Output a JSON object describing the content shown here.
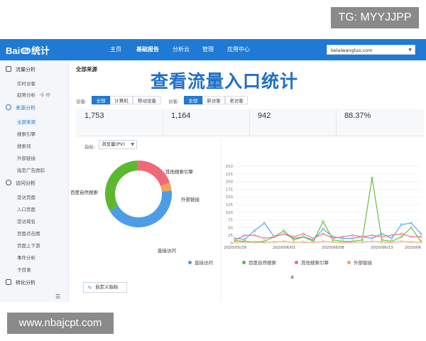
{
  "watermarks": {
    "tg": "TG: MYYJJPP",
    "site": "www.nbajcpt.com"
  },
  "header": {
    "logo_left": "Bai",
    "logo_mid": "du",
    "logo_right": "统计",
    "nav": [
      "主页",
      "基础报告",
      "分析云",
      "管理",
      "应用中心"
    ],
    "active_nav": "基础报告",
    "site_value": "kelaiwangluo.com",
    "brand_color": "#1e7ad4"
  },
  "sidebar": {
    "sections": [
      {
        "title": "流量分析",
        "items": [
          "实时访客",
          "趋势分析"
        ]
      },
      {
        "title": "来源分析",
        "items": [
          "全部来源",
          "搜索引擎",
          "搜索词",
          "外部链接",
          "指定广告跟踪"
        ]
      },
      {
        "title": "访问分析",
        "items": [
          "受访页面",
          "入口页面",
          "受访域名",
          "页面点击图",
          "页面上下游",
          "事件分析",
          "子目录"
        ]
      },
      {
        "title": "转化分析",
        "items": []
      }
    ],
    "trend_badge": "今 昨",
    "active_item": "全部来源"
  },
  "main": {
    "crumb": "全部来源",
    "overlay_title": "查看流量入口统计",
    "device_label": "设备:",
    "device_options": [
      "全部",
      "计算机",
      "移动设备"
    ],
    "visitor_label": "访客:",
    "visitor_options": [
      "全部",
      "新访客",
      "老访客"
    ],
    "metrics": [
      "1,753",
      "1,164",
      "942",
      "88.37%"
    ],
    "indicator_label": "指标:",
    "indicator_value": "浏览量(PV)",
    "custom_button": "自定义指标"
  },
  "chart_data": [
    {
      "type": "pie",
      "style": "donut",
      "labels": [
        "直接访问",
        "百度自然搜索",
        "其他搜索引擎",
        "外部链接"
      ],
      "values": [
        43,
        33,
        20,
        4
      ],
      "colors": [
        "#4d9de6",
        "#5bb830",
        "#ef6a76",
        "#f0a35a"
      ]
    },
    {
      "type": "line",
      "x": [
        "2020/05/29",
        "2020/05/30",
        "2020/05/31",
        "2020/06/01",
        "2020/06/02",
        "2020/06/03",
        "2020/06/04",
        "2020/06/05",
        "2020/06/06",
        "2020/06/07",
        "2020/06/08",
        "2020/06/09",
        "2020/06/10",
        "2020/06/11",
        "2020/06/12",
        "2020/06/13",
        "2020/06/14",
        "2020/06/15",
        "2020/06/16",
        "2020/06/17"
      ],
      "x_ticks": [
        "2020/05/29",
        "2020/06/03",
        "2020/06/08",
        "2020/06/13",
        "2020/06"
      ],
      "ylim": [
        0,
        250
      ],
      "y_ticks": [
        0,
        25,
        50,
        75,
        100,
        125,
        150,
        175,
        200,
        225,
        250
      ],
      "grid": true,
      "legend": "bottom",
      "series": [
        {
          "name": "直接访问",
          "color": "#4d9de6",
          "values": [
            15,
            12,
            40,
            65,
            20,
            30,
            15,
            20,
            10,
            45,
            20,
            15,
            15,
            20,
            15,
            30,
            15,
            60,
            65,
            30
          ]
        },
        {
          "name": "百度自然搜索",
          "color": "#5bb830",
          "values": [
            8,
            5,
            3,
            5,
            20,
            40,
            10,
            20,
            5,
            70,
            10,
            5,
            5,
            10,
            212,
            10,
            5,
            20,
            50,
            5
          ]
        },
        {
          "name": "其他搜索引擎",
          "color": "#ef6a76",
          "values": [
            10,
            25,
            25,
            15,
            20,
            30,
            20,
            30,
            15,
            30,
            15,
            20,
            25,
            20,
            25,
            20,
            25,
            30,
            20,
            20
          ]
        },
        {
          "name": "外部链接",
          "color": "#f0a35a",
          "values": [
            2,
            3,
            2,
            2,
            3,
            5,
            2,
            3,
            2,
            5,
            3,
            2,
            2,
            3,
            5,
            3,
            2,
            5,
            3,
            2
          ]
        }
      ]
    }
  ]
}
